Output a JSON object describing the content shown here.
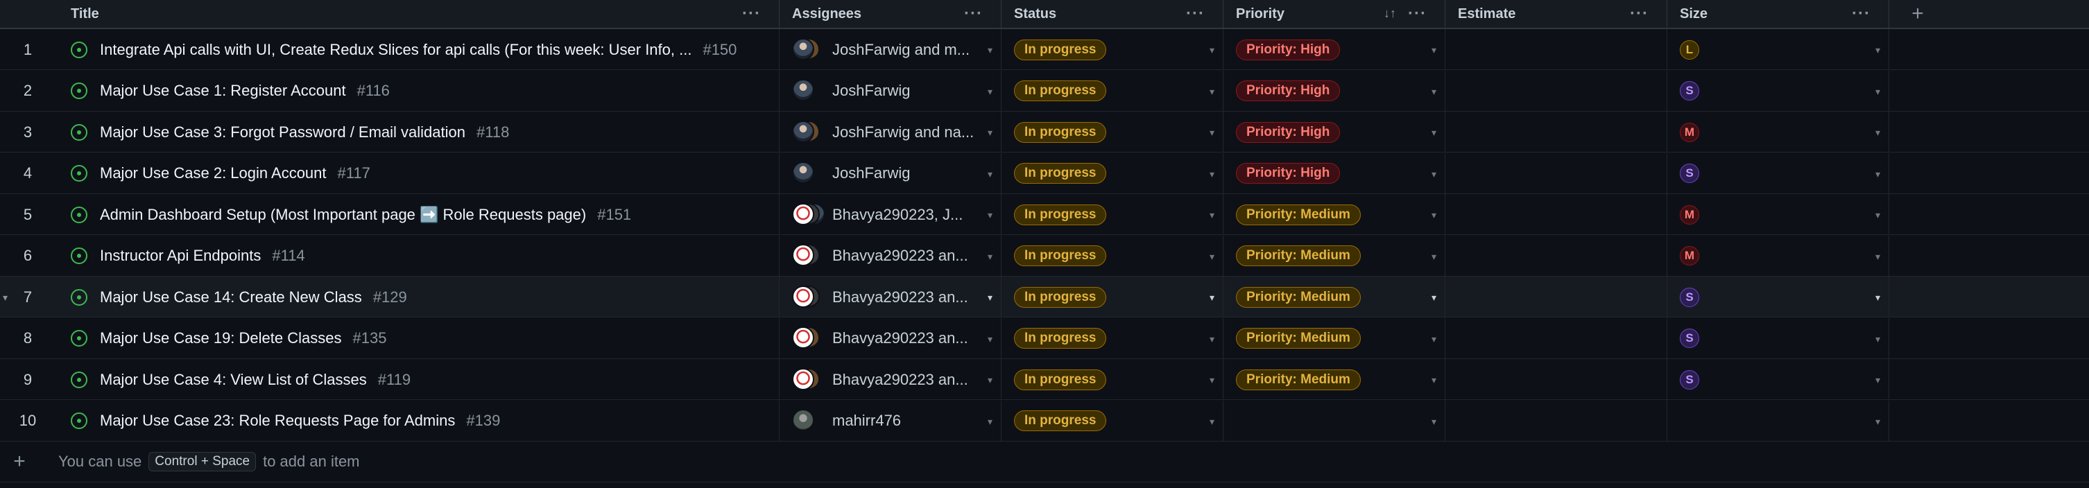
{
  "columns": {
    "title": "Title",
    "assignees": "Assignees",
    "status": "Status",
    "priority": "Priority",
    "estimate": "Estimate",
    "size": "Size",
    "menu_glyph": "···",
    "add_glyph": "+",
    "sort_glyph": "↓↑"
  },
  "rows": [
    {
      "num": "1",
      "title": "Integrate Api calls with UI, Create Redux Slices for api calls (For this week: User Info, ...",
      "issue": "#150",
      "assignee": "JoshFarwig and m...",
      "avatars": [
        "josh",
        "other"
      ],
      "status": "In progress",
      "priority": "Priority: High",
      "prio_level": "high",
      "size": "L"
    },
    {
      "num": "2",
      "title": "Major Use Case 1: Register Account",
      "issue": "#116",
      "assignee": "JoshFarwig",
      "avatars": [
        "josh"
      ],
      "status": "In progress",
      "priority": "Priority: High",
      "prio_level": "high",
      "size": "S"
    },
    {
      "num": "3",
      "title": "Major Use Case 3: Forgot Password / Email validation",
      "issue": "#118",
      "assignee": "JoshFarwig and na...",
      "avatars": [
        "josh",
        "other"
      ],
      "status": "In progress",
      "priority": "Priority: High",
      "prio_level": "high",
      "size": "M"
    },
    {
      "num": "4",
      "title": "Major Use Case 2: Login Account",
      "issue": "#117",
      "assignee": "JoshFarwig",
      "avatars": [
        "josh"
      ],
      "status": "In progress",
      "priority": "Priority: High",
      "prio_level": "high",
      "size": "S"
    },
    {
      "num": "5",
      "title": "Admin Dashboard Setup (Most Important page ➡️ Role Requests page)",
      "issue": "#151",
      "assignee": "Bhavya290223, J...",
      "avatars": [
        "bhavya",
        "j2",
        "josh"
      ],
      "status": "In progress",
      "priority": "Priority: Medium",
      "prio_level": "med",
      "size": "M"
    },
    {
      "num": "6",
      "title": "Instructor Api Endpoints",
      "issue": "#114",
      "assignee": "Bhavya290223 an...",
      "avatars": [
        "bhavya",
        "j2"
      ],
      "status": "In progress",
      "priority": "Priority: Medium",
      "prio_level": "med",
      "size": "M"
    },
    {
      "num": "7",
      "title": "Major Use Case 14: Create New Class",
      "issue": "#129",
      "assignee": "Bhavya290223 an...",
      "avatars": [
        "bhavya",
        "j2"
      ],
      "status": "In progress",
      "priority": "Priority: Medium",
      "prio_level": "med",
      "size": "S",
      "highlight": true
    },
    {
      "num": "8",
      "title": "Major Use Case 19: Delete Classes",
      "issue": "#135",
      "assignee": "Bhavya290223 an...",
      "avatars": [
        "bhavya",
        "other"
      ],
      "status": "In progress",
      "priority": "Priority: Medium",
      "prio_level": "med",
      "size": "S"
    },
    {
      "num": "9",
      "title": "Major Use Case 4: View List of Classes",
      "issue": "#119",
      "assignee": "Bhavya290223 an...",
      "avatars": [
        "bhavya",
        "other"
      ],
      "status": "In progress",
      "priority": "Priority: Medium",
      "prio_level": "med",
      "size": "S"
    },
    {
      "num": "10",
      "title": "Major Use Case 23: Role Requests Page for Admins",
      "issue": "#139",
      "assignee": "mahirr476",
      "avatars": [
        "mahir"
      ],
      "status": "In progress",
      "priority": "",
      "prio_level": "",
      "size": ""
    }
  ],
  "footer": {
    "add_glyph": "+",
    "hint_pre": "You can use",
    "hint_key": "Control + Space",
    "hint_post": "to add an item"
  },
  "colors": {
    "background": "#0d1117",
    "open_issue_green": "#3fb950",
    "in_progress": "#e3b341",
    "priority_high": "#ff7b72",
    "size_small": "#c297ff"
  }
}
